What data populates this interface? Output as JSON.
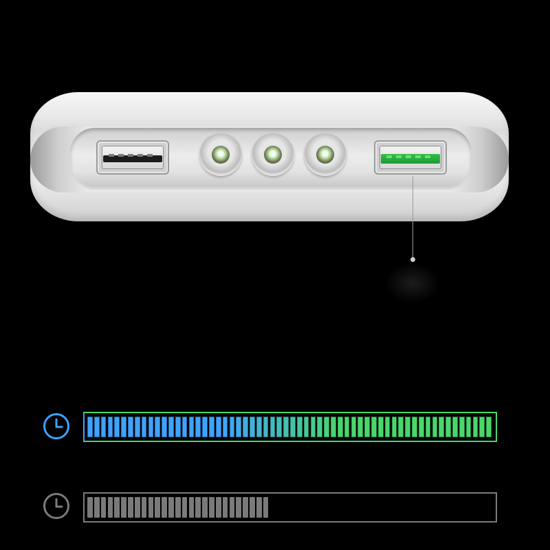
{
  "product": {
    "ports": [
      {
        "icon": "usb-a-port-icon",
        "color": "#1c1c1c"
      },
      {
        "icon": "usb-a-fast-charge-port-icon",
        "color": "#2fbf46"
      }
    ],
    "leds": [
      "led-icon",
      "led-icon",
      "led-icon"
    ]
  },
  "charge_bars": [
    {
      "icon": "clock-icon",
      "level": 1.0,
      "segments_total": 60,
      "colors": {
        "start": "#3ea3ff",
        "end": "#48d86a"
      }
    },
    {
      "icon": "clock-icon",
      "level": 0.45,
      "segments_total": 60,
      "colors": {
        "start": "#7a7a7a",
        "end": "#7a7a7a"
      }
    }
  ]
}
